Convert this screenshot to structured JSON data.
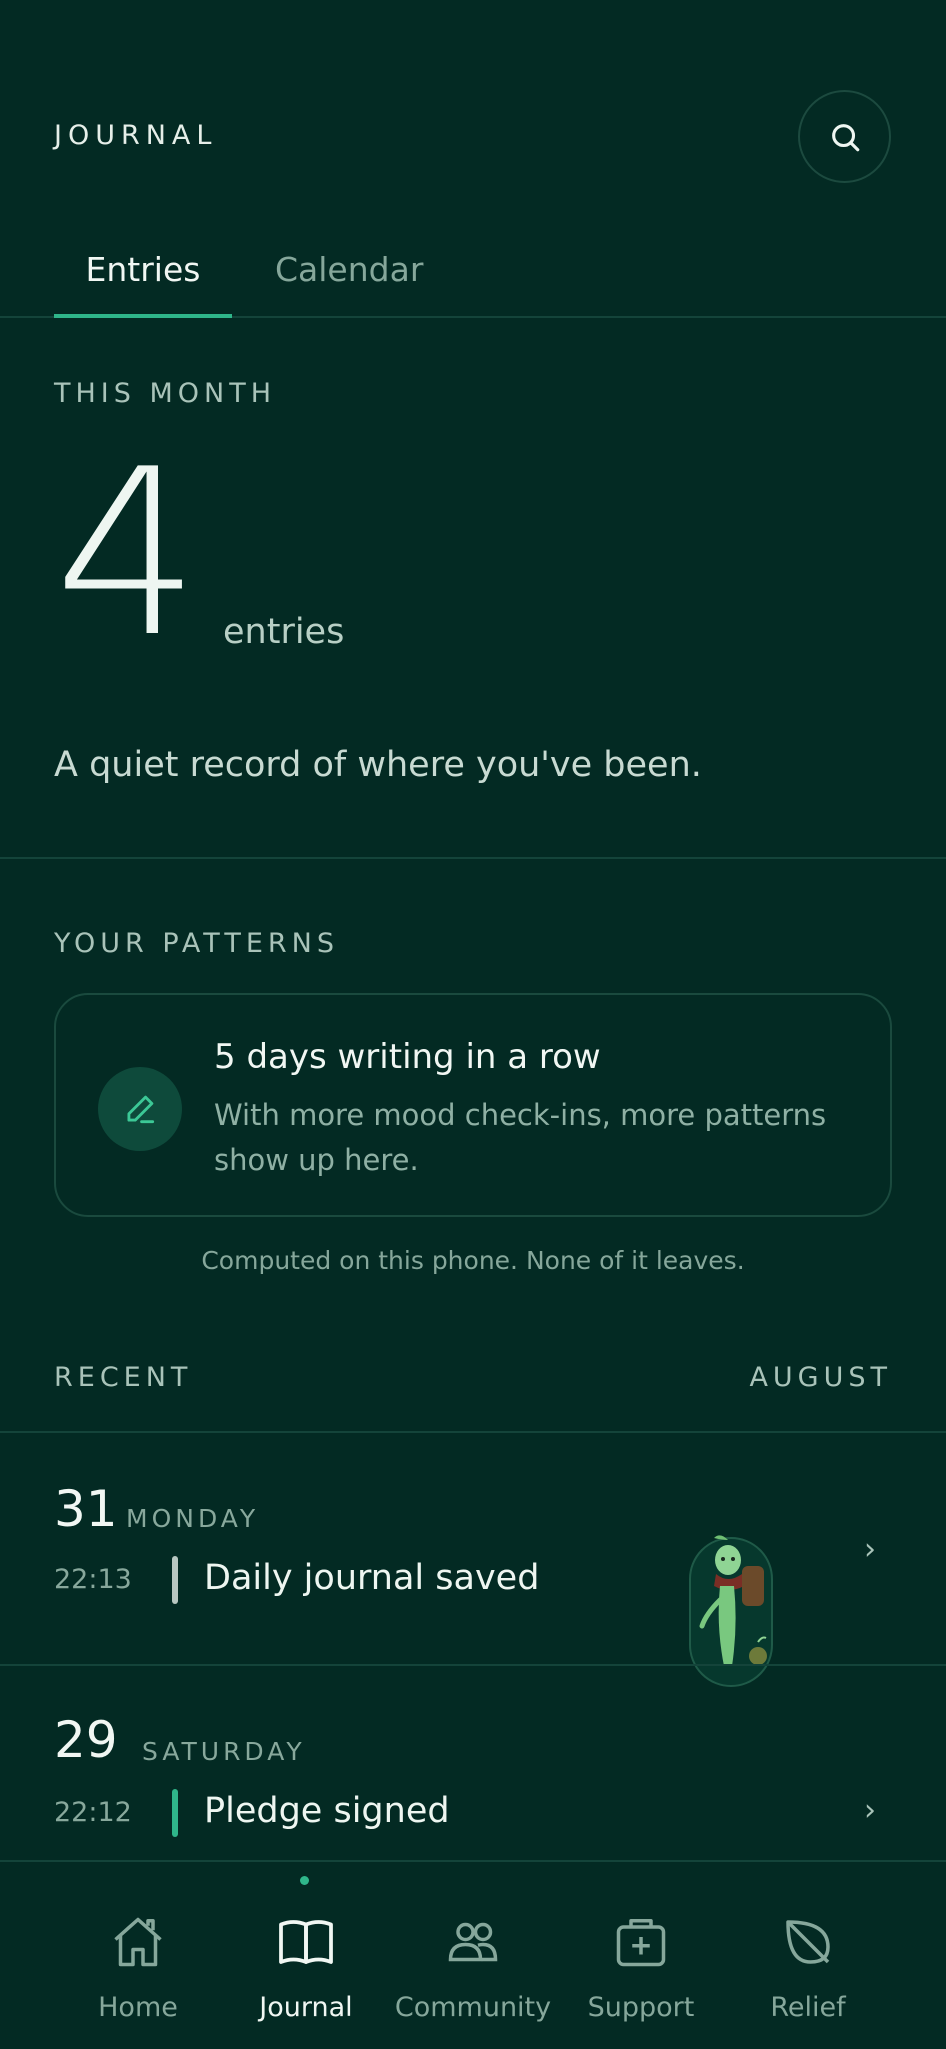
{
  "header": {
    "title": "JOURNAL",
    "search_icon": "search-icon"
  },
  "tabs": [
    {
      "label": "Entries",
      "active": true
    },
    {
      "label": "Calendar",
      "active": false
    }
  ],
  "this_month": {
    "label": "THIS MONTH",
    "count": "4",
    "unit": "entries",
    "tagline": "A quiet record of where you've been."
  },
  "patterns": {
    "label": "YOUR PATTERNS",
    "card": {
      "icon": "pencil-icon",
      "title": "5 days writing in a row",
      "body": "With more mood check-ins, more patterns show up here."
    },
    "note": "Computed on this phone. None of it leaves."
  },
  "recent": {
    "label": "RECENT",
    "month": "AUGUST",
    "entries": [
      {
        "day": "31",
        "weekday": "MONDAY",
        "time": "22:13",
        "title": "Daily journal saved",
        "bar_color": "#b8c7c1"
      },
      {
        "day": "29",
        "weekday": "SATURDAY",
        "time": "22:12",
        "title": "Pledge signed",
        "bar_color": "#2fb68a"
      }
    ]
  },
  "nav": {
    "items": [
      {
        "label": "Home",
        "icon": "home-icon",
        "active": false
      },
      {
        "label": "Journal",
        "icon": "book-icon",
        "active": true
      },
      {
        "label": "Community",
        "icon": "people-icon",
        "active": false
      },
      {
        "label": "Support",
        "icon": "medical-kit-icon",
        "active": false
      },
      {
        "label": "Relief",
        "icon": "leaf-icon",
        "active": false
      }
    ]
  },
  "colors": {
    "background": "#032a23",
    "accent": "#2fb68a",
    "divider": "#14443a"
  }
}
